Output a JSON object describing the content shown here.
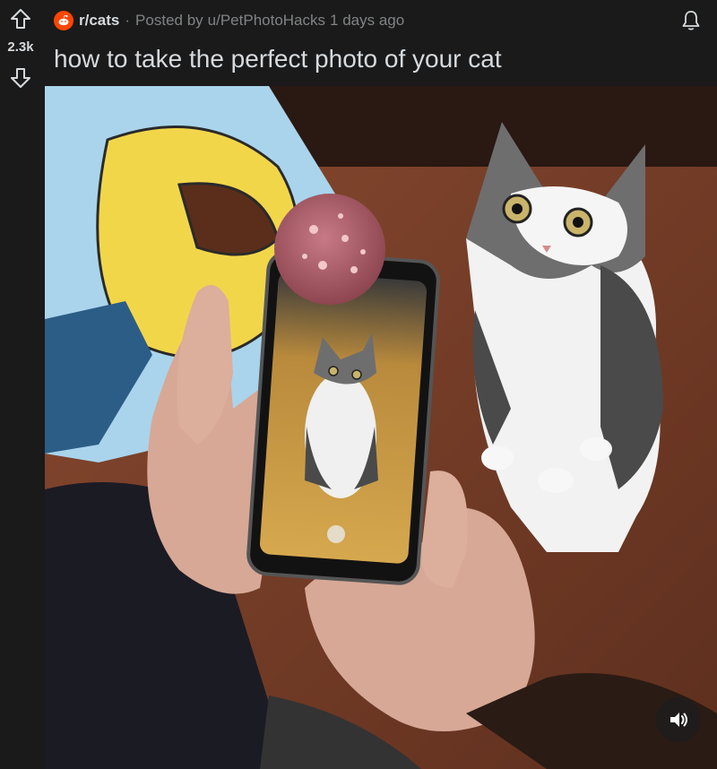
{
  "post": {
    "subreddit": "r/cats",
    "separator": "·",
    "posted_by_prefix": "Posted by",
    "author": "u/PetPhotoHacks",
    "time_ago": "1 days ago",
    "score": "2.3k",
    "title": "how to take the perfect photo of your cat"
  },
  "icons": {
    "upvote": "upvote-arrow-icon",
    "downvote": "downvote-arrow-icon",
    "subreddit_avatar": "reddit-alien-icon",
    "notifications": "bell-icon",
    "audio": "speaker-icon"
  },
  "colors": {
    "background": "#1a1a1b",
    "text": "#d7dadc",
    "muted": "#818384",
    "brand": "#ff4500"
  }
}
